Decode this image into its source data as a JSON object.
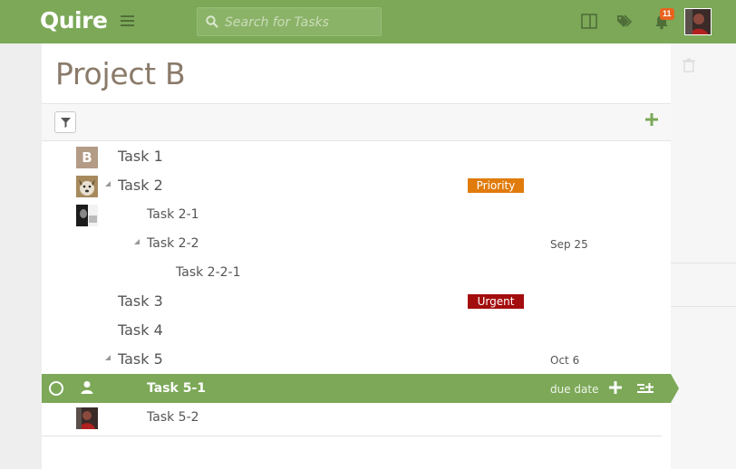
{
  "app": {
    "logo": "Quire"
  },
  "search": {
    "placeholder": "Search for Tasks"
  },
  "notifications": {
    "count": "11"
  },
  "project": {
    "title": "Project B"
  },
  "tasks": [
    {
      "name": "Task 1",
      "avatar": "B",
      "level": 1
    },
    {
      "name": "Task 2",
      "tag": "Priority",
      "tag_color": "#e07b0c",
      "level": 1,
      "expanded": true
    },
    {
      "name": "Task 2-1",
      "level": 2
    },
    {
      "name": "Task 2-2",
      "due": "Sep 25",
      "level": 2,
      "expanded": true
    },
    {
      "name": "Task 2-2-1",
      "level": 3
    },
    {
      "name": "Task 3",
      "tag": "Urgent",
      "tag_color": "#a40d0d",
      "level": 1
    },
    {
      "name": "Task 4",
      "level": 1
    },
    {
      "name": "Task 5",
      "due": "Oct 6",
      "level": 1,
      "expanded": true
    },
    {
      "name": "Task 5-1",
      "due": "due date",
      "level": 2,
      "selected": true
    },
    {
      "name": "Task 5-2",
      "level": 2
    }
  ],
  "colors": {
    "brand": "#7ca858",
    "title": "#8a7a69",
    "priority": "#e07b0c",
    "urgent": "#a40d0d",
    "badge": "#e8631e"
  },
  "icons": [
    "menu-icon",
    "search-icon",
    "panel-icon",
    "tags-icon",
    "bell-icon",
    "filter-icon",
    "plus-icon",
    "trash-icon",
    "user-icon",
    "add-subtask-icon"
  ]
}
